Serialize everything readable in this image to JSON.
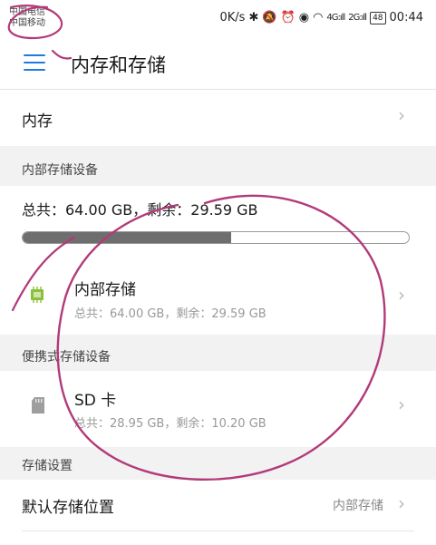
{
  "status": {
    "carrier1": "中国电信",
    "carrier2": "中国移动",
    "speed": "0K/s",
    "icons": [
      "bluetooth-icon",
      "mute-icon",
      "alarm-icon",
      "eye-icon",
      "wifi-icon"
    ],
    "signal1": "4G:ıll",
    "signal2": "2G:ıll",
    "battery": "48",
    "time": "00:44"
  },
  "appbar": {
    "title": "内存和存储",
    "menu_icon": "menu-icon"
  },
  "memory_row": {
    "label": "内存"
  },
  "internal_section": {
    "header": "内部存储设备",
    "summary": "总共：64.00 GB，剩余：29.59 GB",
    "used_fraction": 0.54,
    "item": {
      "title": "内部存储",
      "subtitle": "总共：64.00 GB，剩余：29.59 GB",
      "icon": "chip-icon"
    }
  },
  "portable_section": {
    "header": "便携式存储设备",
    "item": {
      "title": "SD 卡",
      "subtitle": "总共：28.95 GB，剩余：10.20 GB",
      "icon": "sd-card-icon"
    }
  },
  "storage_settings": {
    "header": "存储设置",
    "default_location": {
      "label": "默认存储位置",
      "value": "内部存储"
    }
  },
  "colors": {
    "accent": "#1f7ae0",
    "annotation": "#b23a7a",
    "bar_fill": "#6e6e6e"
  }
}
